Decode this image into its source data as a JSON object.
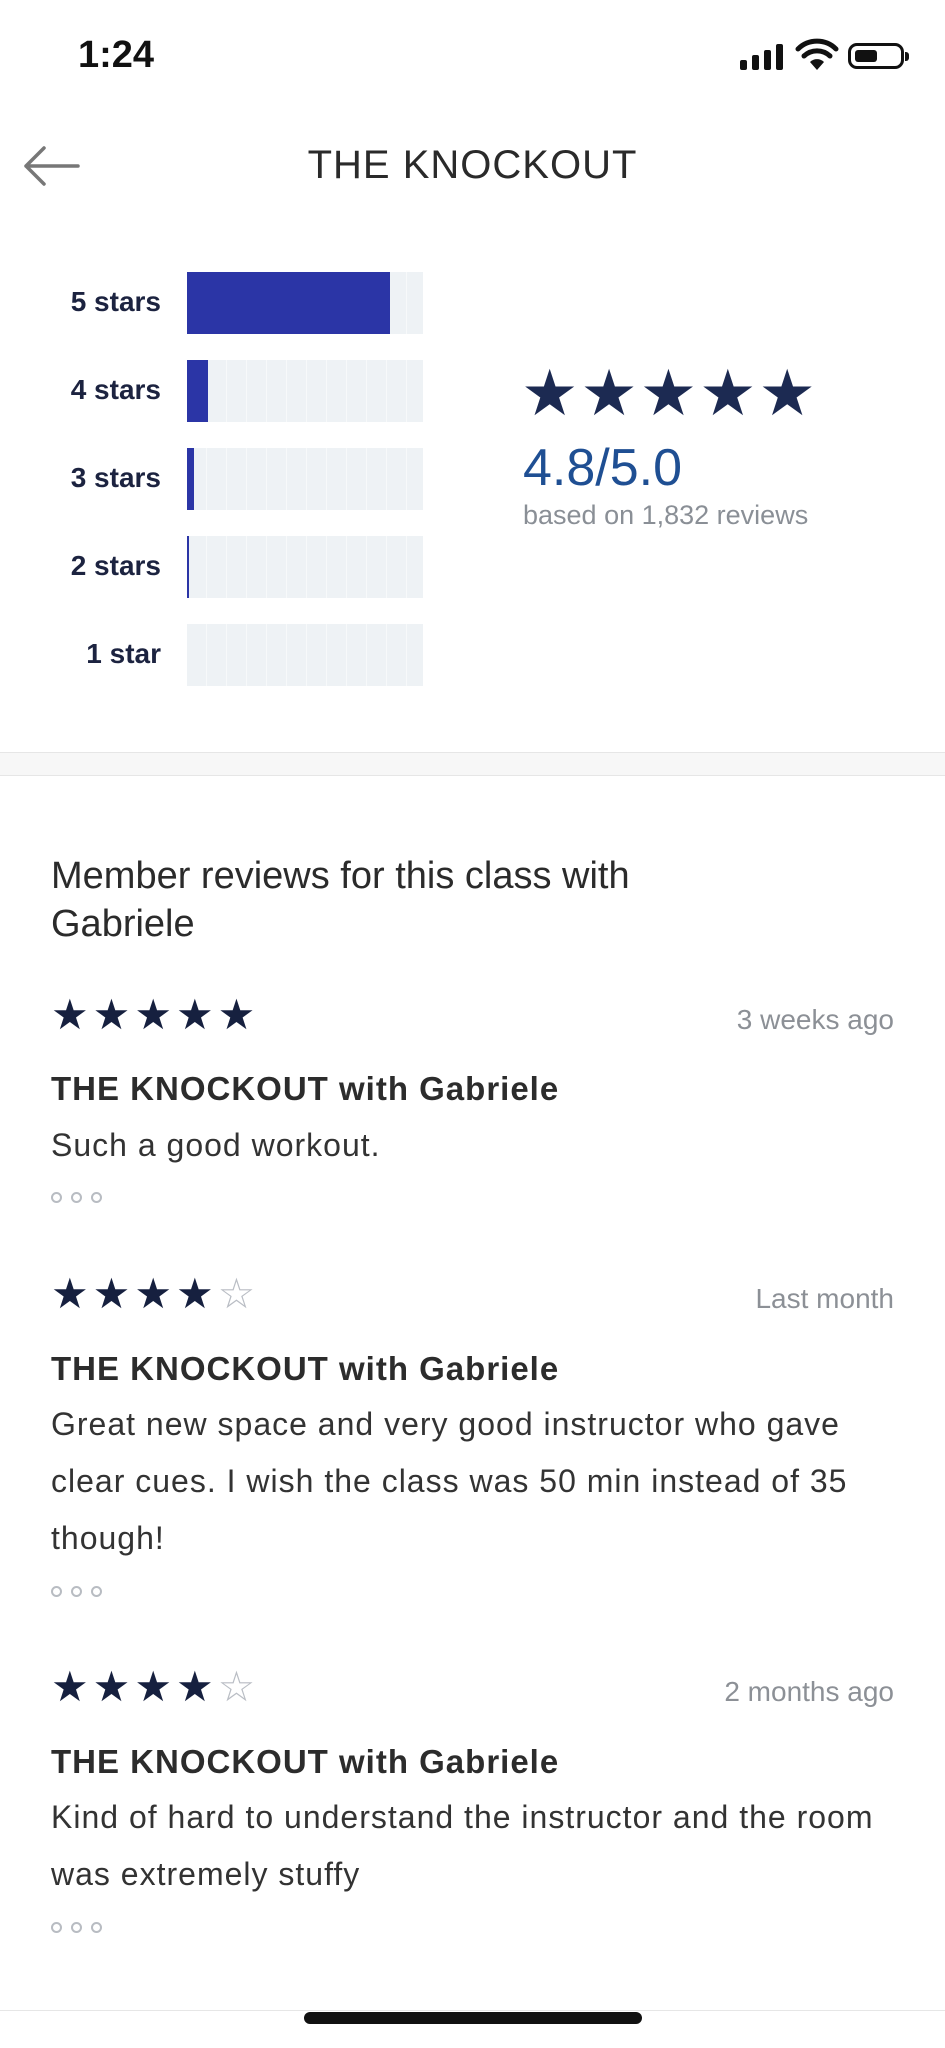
{
  "status_bar": {
    "time": "1:24"
  },
  "header": {
    "title": "THE KNOCKOUT",
    "back_icon": "arrow-left-icon"
  },
  "rating_distribution": [
    {
      "label": "5 stars",
      "fraction": 0.86
    },
    {
      "label": "4 stars",
      "fraction": 0.09
    },
    {
      "label": "3 stars",
      "fraction": 0.03
    },
    {
      "label": "2 stars",
      "fraction": 0.004
    },
    {
      "label": "1 star",
      "fraction": 0.0
    }
  ],
  "summary": {
    "stars": "★★★★★",
    "average": "4.8/5.0",
    "based_on": "based on 1,832 reviews"
  },
  "members_heading": "Member reviews for this class with Gabriele",
  "reviews": [
    {
      "rating": 5,
      "date": "3 weeks ago",
      "title": "THE KNOCKOUT with Gabriele",
      "body": "Such a good workout."
    },
    {
      "rating": 4,
      "date": "Last month",
      "title": "THE KNOCKOUT with Gabriele",
      "body": "Great new space and very good instructor who gave clear cues. I wish the class was 50 min instead of 35 though!"
    },
    {
      "rating": 4,
      "date": "2 months ago",
      "title": "THE KNOCKOUT with Gabriele",
      "body": "Kind of hard to understand the instructor and the room was extremely stuffy"
    }
  ],
  "colors": {
    "bar_fill": "#2b35a6",
    "bar_track": "#eef2f5",
    "star": "#16203f",
    "average": "#1f4f93"
  }
}
